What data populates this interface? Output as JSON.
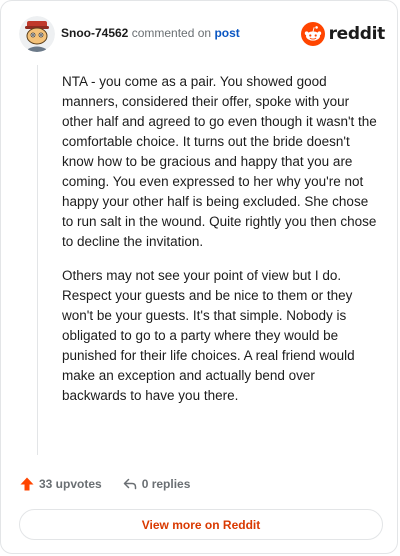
{
  "header": {
    "username": "Snoo-74562",
    "action_text": "commented on",
    "post_link": "post",
    "brand_name": "reddit",
    "brand_color": "#ff4500"
  },
  "comment": {
    "paragraphs": [
      "NTA - you come as a pair. You showed good manners, considered their offer, spoke with your other half and agreed to go even though it wasn't the comfortable choice. It turns out the bride doesn't know how to be gracious and happy that you are coming. You even expressed to her why you're not happy your other half is being excluded. She chose to run salt in the wound. Quite rightly you then chose to decline the invitation.",
      "Others may not see your point of view but I do. Respect your guests and be nice to them or they won't be your guests. It's that simple. Nobody is obligated to go to a party where they would be punished for their life choices. A real friend would make an exception and actually bend over backwards to have you there."
    ]
  },
  "footer": {
    "upvotes_label": "33 upvotes",
    "replies_label": "0 replies",
    "upvote_icon": "upvote-arrow-icon",
    "reply_icon": "reply-arrow-icon",
    "upvote_color": "#ff4500"
  },
  "view_more": {
    "label": "View more on Reddit",
    "color": "#d93900"
  }
}
